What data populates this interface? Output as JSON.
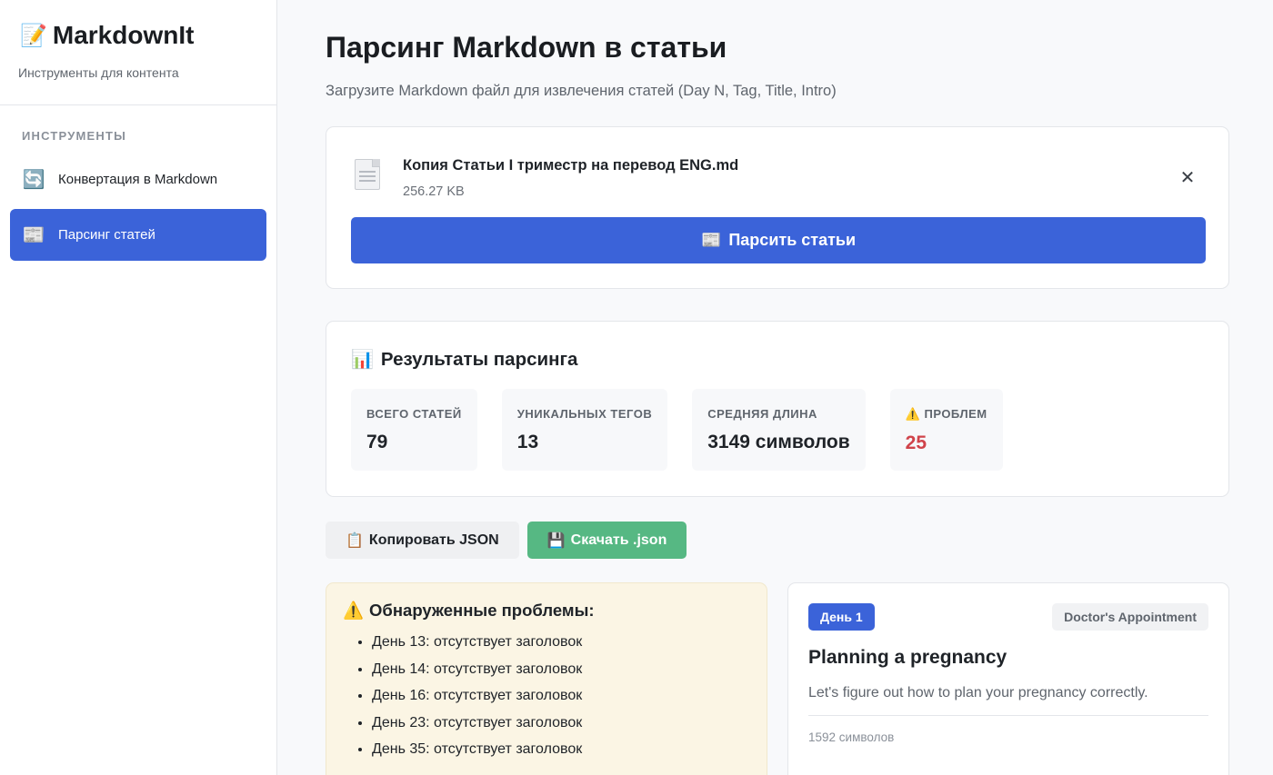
{
  "sidebar": {
    "brand_emoji": "📝",
    "brand_title": "MarkdownIt",
    "brand_subtitle": "Инструменты для контента",
    "section_heading": "ИНСТРУМЕНТЫ",
    "items": [
      {
        "icon": "🔄",
        "icon_name": "refresh-icon",
        "label": "Конвертация в Markdown",
        "active": false
      },
      {
        "icon": "📰",
        "icon_name": "newspaper-icon",
        "label": "Парсинг статей",
        "active": true
      }
    ]
  },
  "main": {
    "title": "Парсинг Markdown в статьи",
    "subtitle": "Загрузите Markdown файл для извлечения статей (Day N, Tag, Title, Intro)"
  },
  "upload": {
    "file_name": "Копия Статьи I триместр на перевод ENG.md",
    "file_size": "256.27 KB",
    "close_symbol": "✕",
    "parse_emoji": "📰",
    "parse_label": "Парсить статьи"
  },
  "results": {
    "emoji": "📊",
    "title": "Результаты парсинга",
    "stats": [
      {
        "label": "ВСЕГО СТАТЕЙ",
        "value": "79"
      },
      {
        "label": "УНИКАЛЬНЫХ ТЕГОВ",
        "value": "13"
      },
      {
        "label": "СРЕДНЯЯ ДЛИНА",
        "value": "3149 символов"
      },
      {
        "label": "⚠️ ПРОБЛЕМ",
        "value": "25"
      }
    ]
  },
  "actions": {
    "copy_emoji": "📋",
    "copy_label": "Копировать JSON",
    "download_emoji": "💾",
    "download_label": "Скачать .json"
  },
  "problems": {
    "emoji": "⚠️",
    "title": "Обнаруженные проблемы:",
    "items": [
      "День 13: отсутствует заголовок",
      "День 14: отсутствует заголовок",
      "День 16: отсутствует заголовок",
      "День 23: отсутствует заголовок",
      "День 35: отсутствует заголовок"
    ]
  },
  "article": {
    "day": "День 1",
    "tag": "Doctor's Appointment",
    "title": "Planning a pregnancy",
    "intro": "Let's figure out how to plan your pregnancy correctly.",
    "length": "1592 символов"
  },
  "colors": {
    "accent": "#3b63d9",
    "success": "#56b883",
    "warning_bg": "#fbf5e4",
    "danger": "#d0434a"
  }
}
